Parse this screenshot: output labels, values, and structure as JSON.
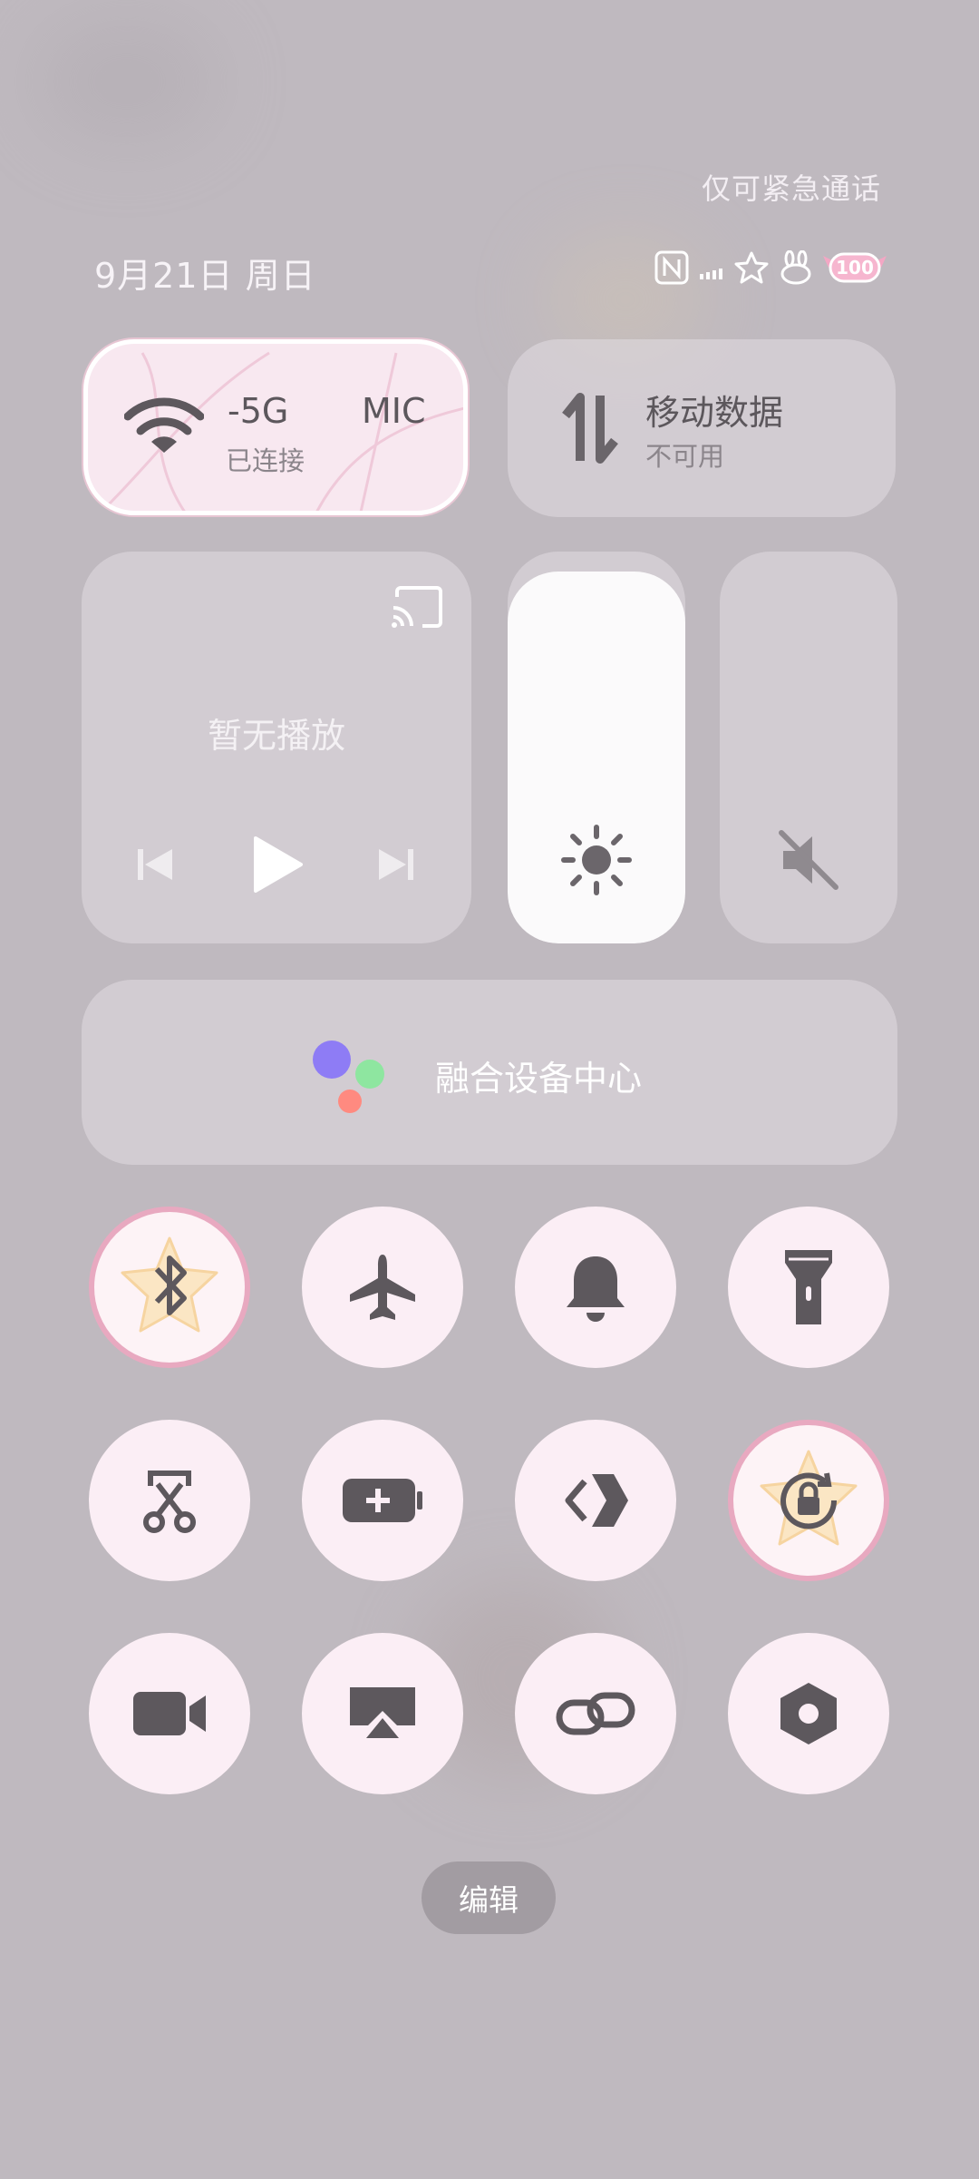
{
  "header": {
    "emergency_text": "仅可紧急通话",
    "date_text": "9月21日 周日",
    "status_icons": [
      "nfc-icon",
      "signal-icon",
      "star-icon",
      "bunny-icon",
      "battery-icon"
    ],
    "battery_text": "100"
  },
  "wifi": {
    "icon": "wifi-icon",
    "ssid_fragment": "-5G",
    "ssid_fragment2": "MIC",
    "status": "已连接"
  },
  "mobile_data": {
    "icon": "data-arrows-icon",
    "title": "移动数据",
    "status": "不可用"
  },
  "media": {
    "no_playback": "暂无播放",
    "cast_icon": "cast-icon",
    "controls": [
      "previous-icon",
      "play-icon",
      "next-icon"
    ]
  },
  "brightness": {
    "icon": "sun-icon",
    "level": 0.95
  },
  "volume": {
    "icon": "volume-mute-icon",
    "level": 0
  },
  "device_center": {
    "label": "融合设备中心"
  },
  "toggles": [
    {
      "icon": "bluetooth-icon",
      "active": true
    },
    {
      "icon": "airplane-icon",
      "active": false
    },
    {
      "icon": "bell-icon",
      "active": false
    },
    {
      "icon": "flashlight-icon",
      "active": false
    },
    {
      "icon": "screenshot-scissors-icon",
      "active": false
    },
    {
      "icon": "battery-saver-icon",
      "active": false
    },
    {
      "icon": "share-connect-icon",
      "active": false
    },
    {
      "icon": "rotation-lock-icon",
      "active": true
    },
    {
      "icon": "video-camera-icon",
      "active": false
    },
    {
      "icon": "screen-cast-icon",
      "active": false
    },
    {
      "icon": "link-icon",
      "active": false
    },
    {
      "icon": "settings-hex-icon",
      "active": false
    }
  ],
  "colors": {
    "panel_bg": "#bfb9bf",
    "tile_bg": "#fbeef5",
    "active_ring": "#e8a9c0",
    "icon_dark": "#5d585d"
  },
  "edit_label": "编辑"
}
